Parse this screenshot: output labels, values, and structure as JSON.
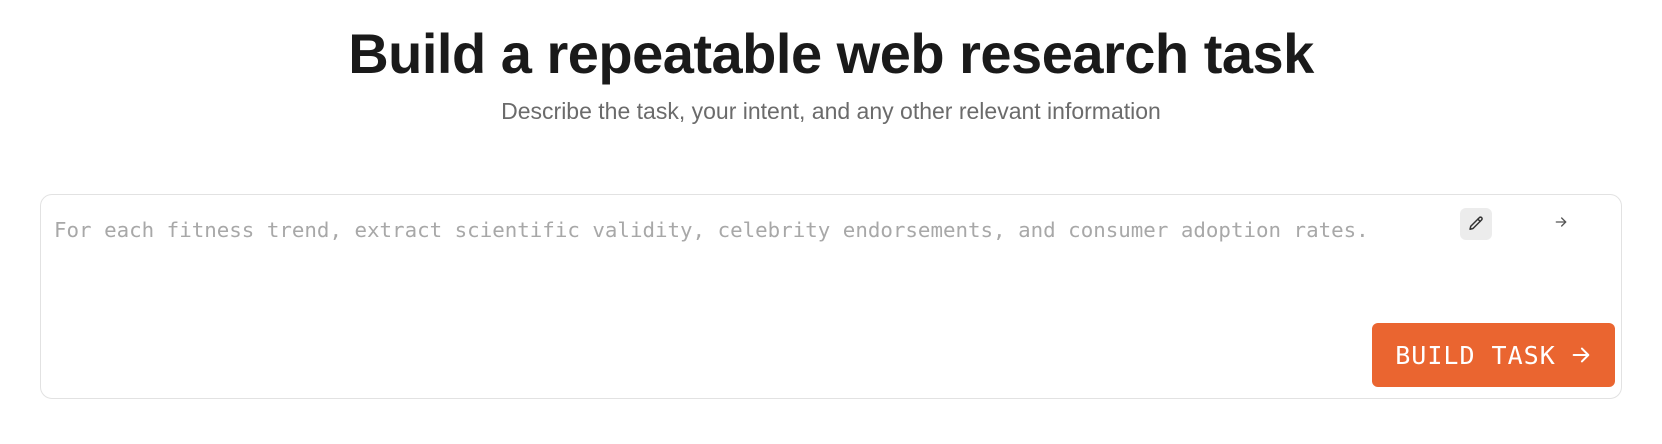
{
  "header": {
    "title": "Build a repeatable web research task",
    "subtitle": "Describe the task, your intent, and any other relevant information"
  },
  "task_card": {
    "input": {
      "value": "",
      "placeholder": "For each fitness trend, extract scientific validity, celebrity endorsements, and consumer adoption rates."
    },
    "edit_icon": "pencil-icon",
    "next_icon": "arrow-right-icon",
    "build_button": {
      "label": "BUILD TASK",
      "icon": "arrow-right-icon"
    }
  },
  "colors": {
    "accent": "#ea6530",
    "title": "#1a1a1a",
    "subtitle": "#6b6b6b",
    "placeholder": "#a8a8a8",
    "card_border": "#e2e2e2",
    "edit_button_bg": "#ececec"
  }
}
